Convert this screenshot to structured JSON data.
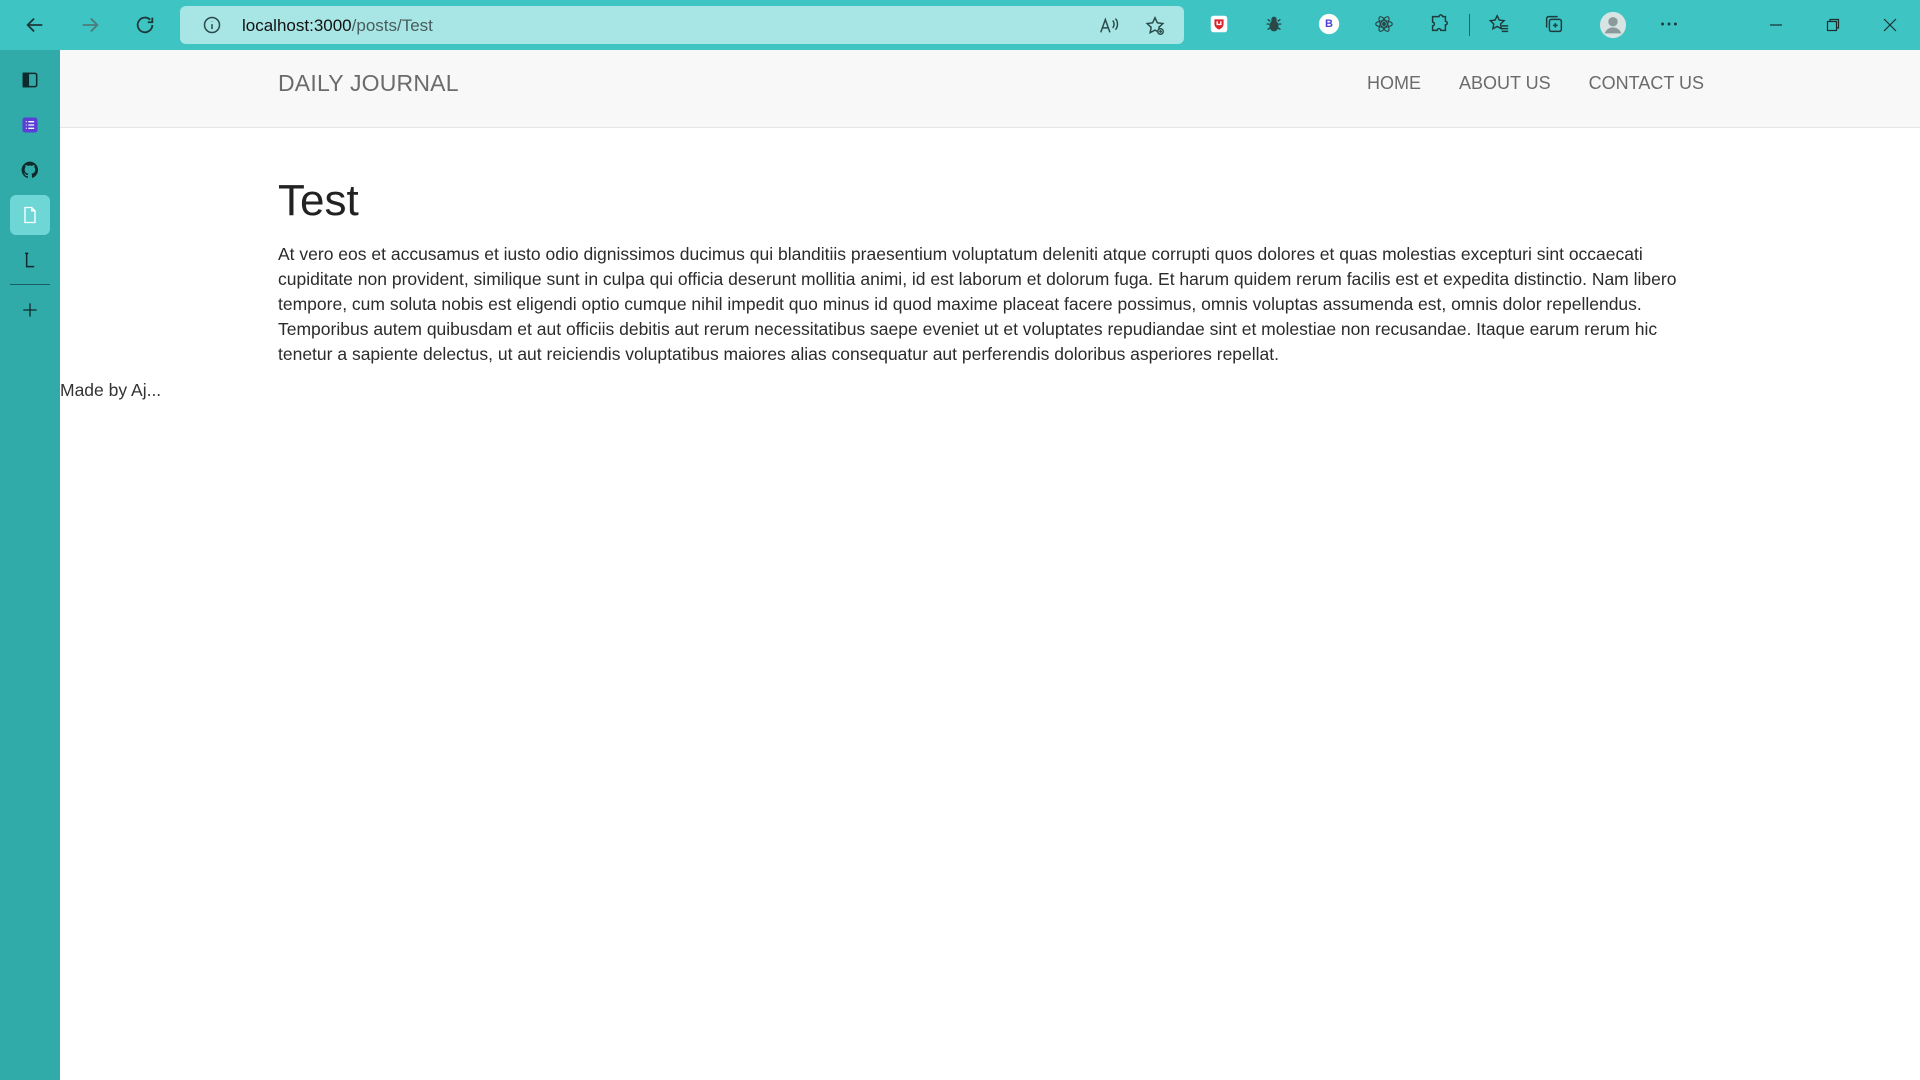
{
  "browser": {
    "url_host": "localhost:3000",
    "url_path": "/posts/Test"
  },
  "site": {
    "brand": "DAILY JOURNAL",
    "nav": [
      {
        "label": "HOME"
      },
      {
        "label": "ABOUT US"
      },
      {
        "label": "CONTACT US"
      }
    ]
  },
  "post": {
    "title": "Test",
    "body": "At vero eos et accusamus et iusto odio dignissimos ducimus qui blanditiis praesentium voluptatum deleniti atque corrupti quos dolores et quas molestias excepturi sint occaecati cupiditate non provident, similique sunt in culpa qui officia deserunt mollitia animi, id est laborum et dolorum fuga. Et harum quidem rerum facilis est et expedita distinctio. Nam libero tempore, cum soluta nobis est eligendi optio cumque nihil impedit quo minus id quod maxime placeat facere possimus, omnis voluptas assumenda est, omnis dolor repellendus. Temporibus autem quibusdam et aut officiis debitis aut rerum necessitatibus saepe eveniet ut et voluptates repudiandae sint et molestiae non recusandae. Itaque earum rerum hic tenetur a sapiente delectus, ut aut reiciendis voluptatibus maiores alias consequatur aut perferendis doloribus asperiores repellat."
  },
  "footer": {
    "text": "Made by Aj..."
  },
  "extensions": {
    "profile_badge": "B"
  },
  "icons": {
    "back": "back-arrow-icon",
    "forward": "forward-arrow-icon",
    "refresh": "refresh-icon",
    "info": "info-icon",
    "read_aloud": "read-aloud-icon",
    "favorite": "add-favorite-icon",
    "menu": "more-menu-icon"
  },
  "colors": {
    "browser_bar": "#3fc4c4",
    "sidebar": "#31aaaa",
    "urlbar": "#a8e6e6"
  }
}
